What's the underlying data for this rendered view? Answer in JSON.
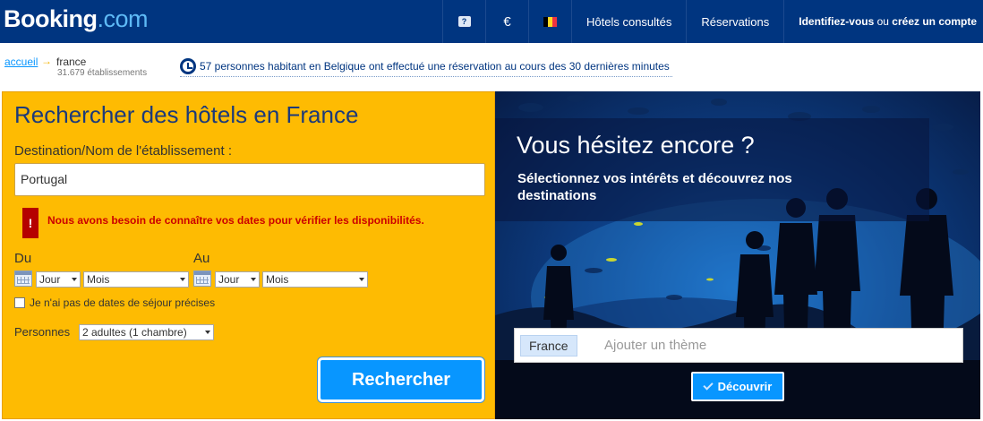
{
  "header": {
    "logo_brand": "Booking",
    "logo_tld": ".com",
    "help_icon": "?",
    "currency": "€",
    "flag_colors": [
      "#000000",
      "#fdda24",
      "#ef3340"
    ],
    "hotels_viewed": "Hôtels consultés",
    "reservations": "Réservations",
    "login_bold": "Identifiez-vous",
    "login_or": " ou ",
    "login_create": "créez un compte"
  },
  "breadcrumb": {
    "home": "accueil",
    "arrow": "→",
    "country": "france",
    "count": "31.679 établissements"
  },
  "notice": {
    "text": "57 personnes habitant en Belgique ont effectué une réservation au cours des 30 dernières minutes"
  },
  "search": {
    "title": "Rechercher des hôtels en France",
    "destination_label": "Destination/Nom de l'établissement :",
    "destination_value": "Portugal",
    "error_icon": "!",
    "error_text": "Nous avons besoin de connaître vos dates pour vérifier les disponibilités.",
    "checkin_label": "Du",
    "checkout_label": "Au",
    "day_select": "Jour",
    "month_select": "Mois",
    "no_dates_label": "Je n'ai pas de dates de séjour précises",
    "persons_label": "Personnes",
    "persons_value": "2 adultes (1 chambre)",
    "submit_label": "Rechercher"
  },
  "inspiration": {
    "title": "Vous hésitez encore ?",
    "subtitle": "Sélectionnez vos intérêts et découvrez nos destinations",
    "tag": "France",
    "placeholder": "Ajouter un thème",
    "button_label": "Découvrir"
  },
  "colors": {
    "header_bg": "#003580",
    "search_bg": "#febb02",
    "button_blue": "#0896ff",
    "error_red": "#b50000"
  }
}
